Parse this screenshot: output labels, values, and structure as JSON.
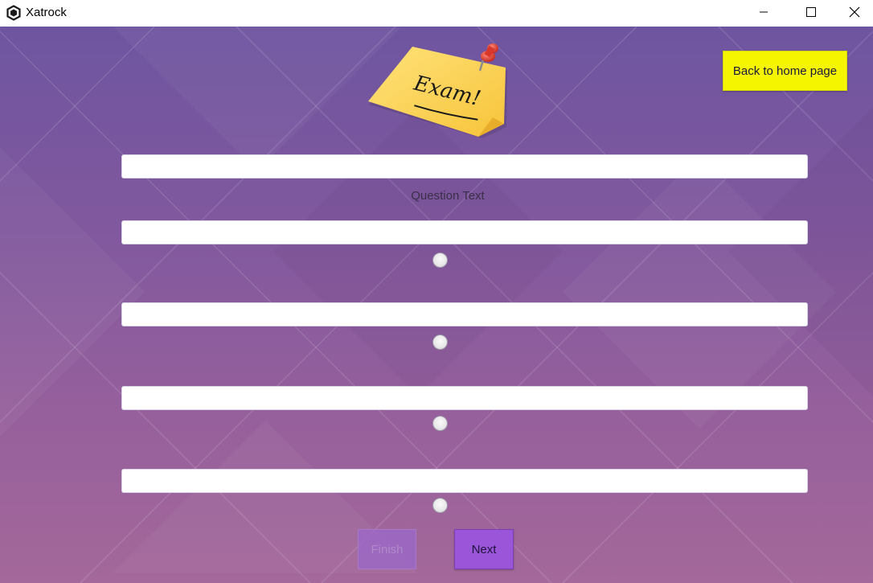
{
  "window": {
    "title": "Xatrock",
    "app_icon": "hexagon-logo-icon",
    "controls": [
      "minimize-icon",
      "maximize-icon",
      "close-icon"
    ]
  },
  "header": {
    "image_label": "Exam!",
    "home_button_label": "Back to home page"
  },
  "question": {
    "field_value": "",
    "label": "Question Text"
  },
  "answers": [
    {
      "value": "",
      "selected": false
    },
    {
      "value": "",
      "selected": false
    },
    {
      "value": "",
      "selected": false
    },
    {
      "value": "",
      "selected": false
    }
  ],
  "actions": {
    "finish_label": "Finish",
    "finish_enabled": false,
    "next_label": "Next"
  },
  "colors": {
    "background_top": "#6e55a0",
    "background_bottom": "#a4689a",
    "home_button": "#f5f500",
    "next_button": "#9b55d8"
  }
}
